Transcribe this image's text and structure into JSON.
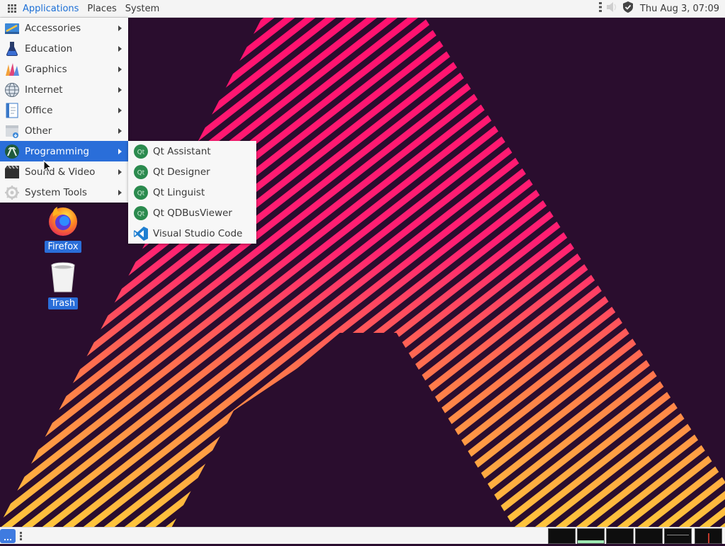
{
  "top_panel": {
    "menus": [
      "Applications",
      "Places",
      "System"
    ],
    "clock": "Thu Aug  3, 07:09",
    "icons": [
      "apps-grid-icon",
      "panel-handle-icon",
      "volume-icon",
      "shield-icon"
    ]
  },
  "applications_menu": {
    "items": [
      {
        "label": "Accessories",
        "icon": "accessories-icon"
      },
      {
        "label": "Education",
        "icon": "education-icon"
      },
      {
        "label": "Graphics",
        "icon": "graphics-icon"
      },
      {
        "label": "Internet",
        "icon": "internet-icon"
      },
      {
        "label": "Office",
        "icon": "office-icon"
      },
      {
        "label": "Other",
        "icon": "other-icon"
      },
      {
        "label": "Programming",
        "icon": "programming-icon",
        "selected": true
      },
      {
        "label": "Sound & Video",
        "icon": "sound-video-icon"
      },
      {
        "label": "System Tools",
        "icon": "system-tools-icon"
      }
    ]
  },
  "programming_submenu": {
    "items": [
      {
        "label": "Qt Assistant",
        "icon": "qt-icon"
      },
      {
        "label": "Qt Designer",
        "icon": "qt-icon"
      },
      {
        "label": "Qt Linguist",
        "icon": "qt-icon"
      },
      {
        "label": "Qt QDBusViewer",
        "icon": "qt-icon"
      },
      {
        "label": "Visual Studio Code",
        "icon": "vscode-icon"
      }
    ]
  },
  "desktop_icons": [
    {
      "label": "Firefox",
      "icon": "firefox-icon"
    },
    {
      "label": "Trash",
      "icon": "trash-icon"
    }
  ],
  "colors": {
    "accent": "#2a6ed9",
    "wallpaper_bg": "#2a0d2e",
    "stripe_pink": "#ff1a73",
    "stripe_yellow": "#ffb52e"
  },
  "bottom_panel": {
    "workspaces": 6
  }
}
